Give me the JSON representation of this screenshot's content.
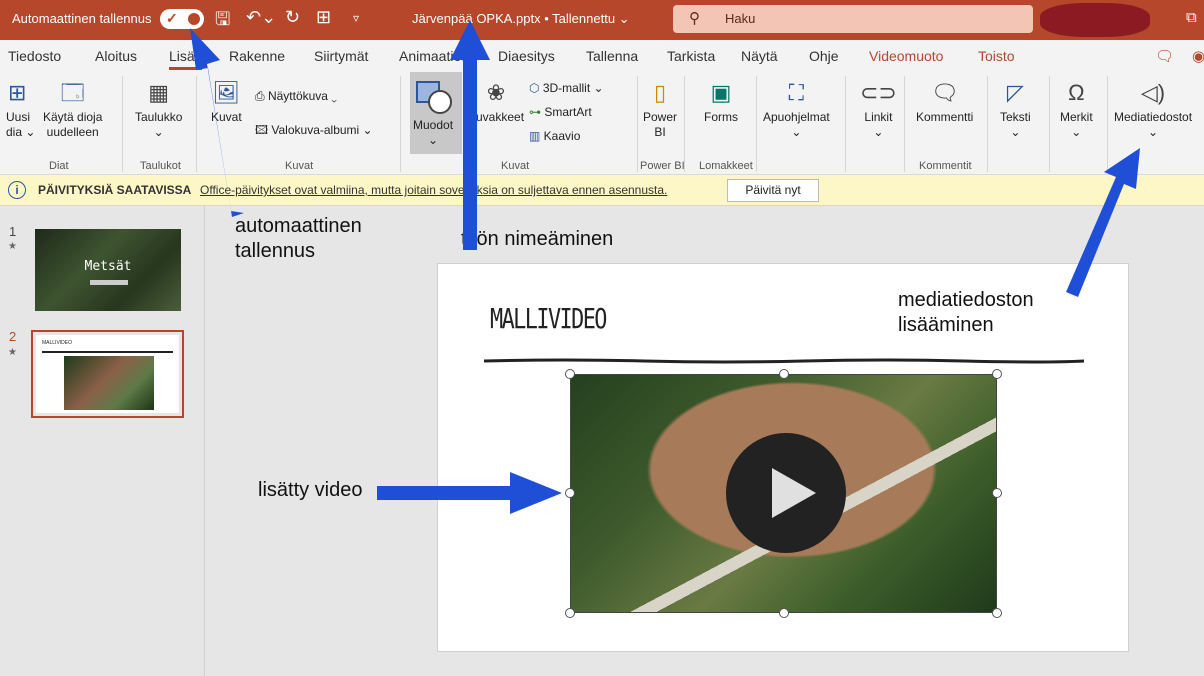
{
  "titlebar": {
    "autosave_label": "Automaattinen tallennus",
    "filename": "Järvenpää OPKA.pptx • Tallennettu ⌄",
    "search_placeholder": "Haku"
  },
  "tabs": [
    "Tiedosto",
    "Aloitus",
    "Lisää",
    "Rakenne",
    "Siirtymät",
    "Animaatiot",
    "Diaesitys",
    "Tallenna",
    "Tarkista",
    "Näytä",
    "Ohje",
    "Videomuoto",
    "Toisto"
  ],
  "ribbon": {
    "uusi_dia": "Uusi",
    "uusi_dia2": "dia ⌄",
    "kayta_dioja": "Käytä dioja",
    "kayta_dioja2": "uudelleen",
    "taulukko": "Taulukko",
    "kuvat": "Kuvat",
    "nayttokuva": "Näyttökuva ⌄",
    "valokuva_albumi": "Valokuva-albumi ⌄",
    "muodot": "Muodot",
    "kuvakkeet": "Kuvakkeet",
    "mallit_3d": "3D-mallit ⌄",
    "smartart": "SmartArt",
    "kaavio": "Kaavio",
    "power_bi": "Power",
    "power_bi2": "BI",
    "forms": "Forms",
    "apuohjelmat": "Apuohjelmat",
    "linkit": "Linkit",
    "kommentti": "Kommentti",
    "teksti": "Teksti",
    "merkit": "Merkit",
    "mediatiedostot": "Mediatiedostot",
    "groups": {
      "diat": "Diat",
      "taulukot": "Taulukot",
      "kuvat": "Kuvat",
      "kuvat2": "Kuvat",
      "power_bi": "Power BI",
      "lomakkeet": "Lomakkeet",
      "kommentit": "Kommentit"
    }
  },
  "infobar": {
    "title": "PÄIVITYKSIÄ SAATAVISSA",
    "message": "Office-päivitykset ovat valmiina, mutta joitain sovelluksia on suljettava ennen asennusta.",
    "button": "Päivitä nyt"
  },
  "thumbnails": [
    {
      "number": "1",
      "title": "Metsät"
    },
    {
      "number": "2",
      "title": "MALLIVIDEO"
    }
  ],
  "slide": {
    "title": "MALLIVIDEO"
  },
  "annotations": {
    "autosave_1": "automaattinen",
    "autosave_2": "tallennus",
    "naming": "työn nimeäminen",
    "media_1": "mediatiedoston",
    "media_2": "lisääminen",
    "video": "lisätty video"
  },
  "colors": {
    "accent": "#b7472a",
    "arrow": "#1f4fd6",
    "infobar": "#fdf6c6"
  }
}
